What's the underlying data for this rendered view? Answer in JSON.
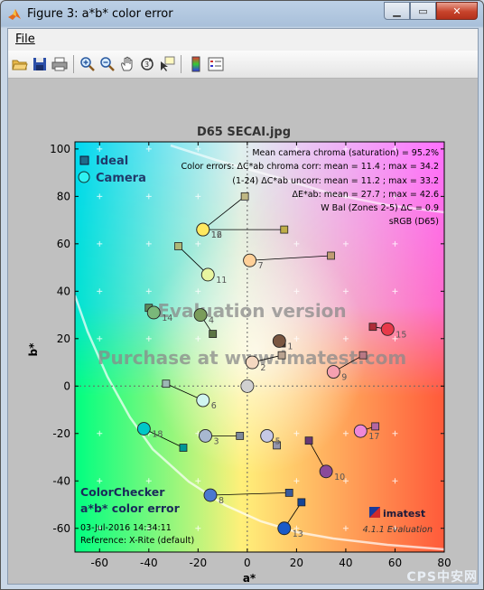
{
  "window": {
    "title": "Figure 3: a*b* color error",
    "controls": {
      "minimize": "▁",
      "maximize": "▭",
      "close": "✕"
    }
  },
  "menubar": {
    "file_label": "File"
  },
  "toolbar": {
    "icons": [
      "open-icon",
      "save-icon",
      "print-icon",
      "zoom-in-icon",
      "zoom-out-icon",
      "pan-icon",
      "rotate-icon",
      "data-cursor-icon",
      "colorbar-icon",
      "legend-icon"
    ]
  },
  "chart_data": {
    "type": "scatter",
    "title": "D65 SECAI.jpg",
    "xlabel": "a*",
    "ylabel": "b*",
    "xlim": [
      -70,
      80
    ],
    "ylim": [
      -70,
      103
    ],
    "xticks": [
      -60,
      -40,
      -20,
      0,
      20,
      40,
      60,
      80
    ],
    "yticks": [
      -60,
      -40,
      -20,
      0,
      20,
      40,
      60,
      80,
      100
    ],
    "grid": false,
    "legend": {
      "position": "top-left",
      "entries": [
        {
          "name": "Ideal",
          "marker": "square"
        },
        {
          "name": "Camera",
          "marker": "circle"
        }
      ]
    },
    "info_lines": [
      "Mean camera chroma (saturation) = 95.2%",
      "Color errors: ΔC*ab chroma corr:  mean = 11.4 ;  max = 34.2",
      "(1-24)    ΔC*ab uncorr:  mean = 11.2 ;  max = 33.2",
      "ΔE*ab:  mean = 27.7 ;  max = 42.6",
      "W Bal (Zones 2-5) ΔC = 0.9",
      "sRGB (D65)"
    ],
    "bottom_left": [
      "ColorChecker",
      "a*b* color error",
      "03-Jul-2016 14:34:11",
      "Reference: X-Rite (default)"
    ],
    "watermark": [
      "Evaluation version",
      "Purchase at www.imatest.com"
    ],
    "logo": "imatest",
    "version": "4.1.1  Evaluation",
    "patches": [
      {
        "id": 1,
        "ideal": [
          14,
          18
        ],
        "camera": [
          13,
          19
        ],
        "color": "#7a5640"
      },
      {
        "id": 2,
        "ideal": [
          14,
          13
        ],
        "camera": [
          2,
          10
        ],
        "color": "#f5d8c0"
      },
      {
        "id": 3,
        "ideal": [
          -3,
          -21
        ],
        "camera": [
          -17,
          -21
        ],
        "color": "#a8b8d0"
      },
      {
        "id": 4,
        "ideal": [
          -14,
          22
        ],
        "camera": [
          -19,
          30
        ],
        "color": "#7a9c5a"
      },
      {
        "id": 5,
        "ideal": [
          12,
          -25
        ],
        "camera": [
          8,
          -21
        ],
        "color": "#c6c8e6"
      },
      {
        "id": 6,
        "ideal": [
          -33,
          1
        ],
        "camera": [
          -18,
          -6
        ],
        "color": "#d0f5f0"
      },
      {
        "id": 7,
        "ideal": [
          34,
          55
        ],
        "camera": [
          1,
          53
        ],
        "color": "#ffd098"
      },
      {
        "id": 8,
        "ideal": [
          17,
          -45
        ],
        "camera": [
          -15,
          -46
        ],
        "color": "#4a78d0"
      },
      {
        "id": 9,
        "ideal": [
          47,
          13
        ],
        "camera": [
          35,
          6
        ],
        "color": "#f5a0b0"
      },
      {
        "id": 10,
        "ideal": [
          25,
          -23
        ],
        "camera": [
          32,
          -36
        ],
        "color": "#8a4a9a"
      },
      {
        "id": 11,
        "ideal": [
          -28,
          59
        ],
        "camera": [
          -16,
          47
        ],
        "color": "#e8f5a0"
      },
      {
        "id": 12,
        "ideal": [
          -1,
          80
        ],
        "camera": [
          -18,
          66
        ],
        "color": "#fff5b0"
      },
      {
        "id": 13,
        "ideal": [
          22,
          -49
        ],
        "camera": [
          15,
          -60
        ],
        "color": "#1a5ac8"
      },
      {
        "id": 14,
        "ideal": [
          -40,
          33
        ],
        "camera": [
          -38,
          31
        ],
        "color": "#7ab87a"
      },
      {
        "id": 15,
        "ideal": [
          51,
          25
        ],
        "camera": [
          57,
          24
        ],
        "color": "#e83a4a"
      },
      {
        "id": 16,
        "ideal": [
          15,
          66
        ],
        "camera": [
          -18,
          66
        ],
        "color": "#ffe860"
      },
      {
        "id": 17,
        "ideal": [
          52,
          -17
        ],
        "camera": [
          46,
          -19
        ],
        "color": "#ee88d8"
      },
      {
        "id": 18,
        "ideal": [
          -26,
          -26
        ],
        "camera": [
          -42,
          -18
        ],
        "color": "#00c8c8"
      },
      {
        "id": 19,
        "ideal": [
          0,
          0
        ],
        "camera": [
          0,
          0
        ],
        "color": "#ffffff"
      },
      {
        "id": 20,
        "ideal": [
          0,
          0
        ],
        "camera": [
          0,
          0
        ],
        "color": "#f0f0f0"
      },
      {
        "id": 21,
        "ideal": [
          0,
          0
        ],
        "camera": [
          0,
          0
        ],
        "color": "#e8e8e8"
      },
      {
        "id": 22,
        "ideal": [
          0,
          0
        ],
        "camera": [
          0,
          0
        ],
        "color": "#e0e0e0"
      },
      {
        "id": 23,
        "ideal": [
          0,
          0
        ],
        "camera": [
          0,
          0
        ],
        "color": "#d8d8d8"
      },
      {
        "id": 24,
        "ideal": [
          0,
          0
        ],
        "camera": [
          0,
          0
        ],
        "color": "#d0d0d0"
      }
    ]
  },
  "footer_watermark": "CPS中安网"
}
